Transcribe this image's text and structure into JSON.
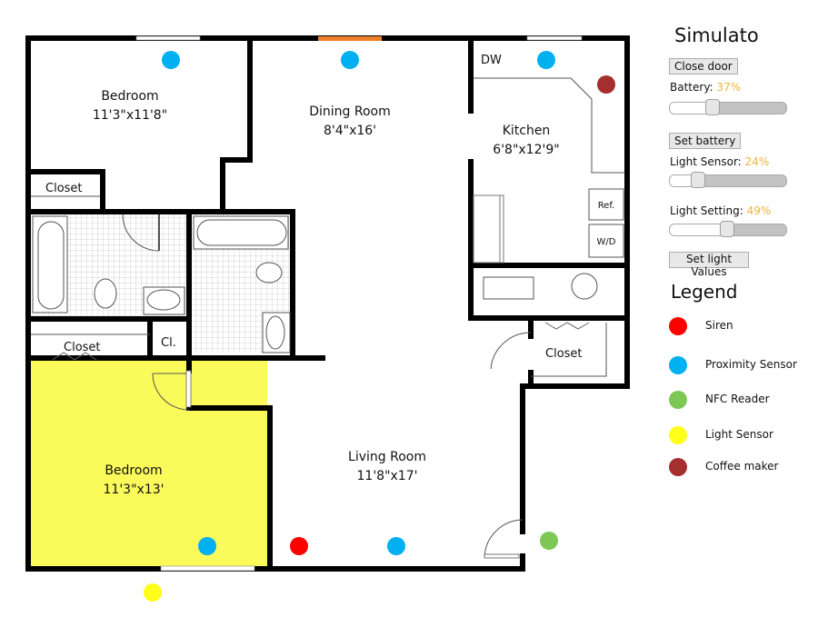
{
  "window": {
    "title": "Simulato"
  },
  "controls": {
    "close_door_label": "Close door",
    "battery_label": "Battery: ",
    "battery_value": "37%",
    "battery_fraction": 0.37,
    "set_battery_label": "Set battery",
    "light_sensor_label": "Light Sensor: ",
    "light_sensor_value": "24%",
    "light_sensor_fraction": 0.24,
    "light_setting_label": "Light Setting: ",
    "light_setting_value": "49%",
    "light_setting_fraction": 0.49,
    "set_light_values_label": "Set light Values"
  },
  "legend": {
    "title": "Legend",
    "items": [
      {
        "label": "Siren",
        "color": "#ff0000"
      },
      {
        "label": "Proximity Sensor",
        "color": "#00b0f0"
      },
      {
        "label": "NFC Reader",
        "color": "#7dc855"
      },
      {
        "label": "Light Sensor",
        "color": "#ffff1a"
      },
      {
        "label": "Coffee maker",
        "color": "#a52f2f"
      }
    ]
  },
  "floorplan": {
    "rooms": [
      {
        "name": "Bedroom",
        "size": "11'3\"x11'8\""
      },
      {
        "name": "Dining Room",
        "size": "8'4\"x16'"
      },
      {
        "name": "Kitchen",
        "size": "6'8\"x12'9\""
      },
      {
        "name": "Living Room",
        "size": "11'8\"x17'"
      },
      {
        "name": "Bedroom",
        "size": "11'3\"x13'"
      }
    ],
    "labels": {
      "closet_top": "Closet",
      "closet_mid": "Closet",
      "closet_small": "Cl.",
      "closet_right": "Closet",
      "dishwasher": "DW",
      "refrigerator": "Ref.",
      "washer_dryer": "W/D"
    },
    "colors": {
      "lit_room": "#fafa5a",
      "open_door": "#f07f2a",
      "wall": "#000000"
    },
    "devices": [
      {
        "type": "Proximity Sensor",
        "room": "Bedroom (top)"
      },
      {
        "type": "Proximity Sensor",
        "room": "Dining Room"
      },
      {
        "type": "Proximity Sensor",
        "room": "Kitchen"
      },
      {
        "type": "Coffee maker",
        "room": "Kitchen"
      },
      {
        "type": "Proximity Sensor",
        "room": "Bedroom (bottom)"
      },
      {
        "type": "Siren",
        "room": "Living Room"
      },
      {
        "type": "Proximity Sensor",
        "room": "Living Room"
      },
      {
        "type": "NFC Reader",
        "room": "Entrance"
      },
      {
        "type": "Light Sensor",
        "room": "Outside"
      }
    ]
  }
}
